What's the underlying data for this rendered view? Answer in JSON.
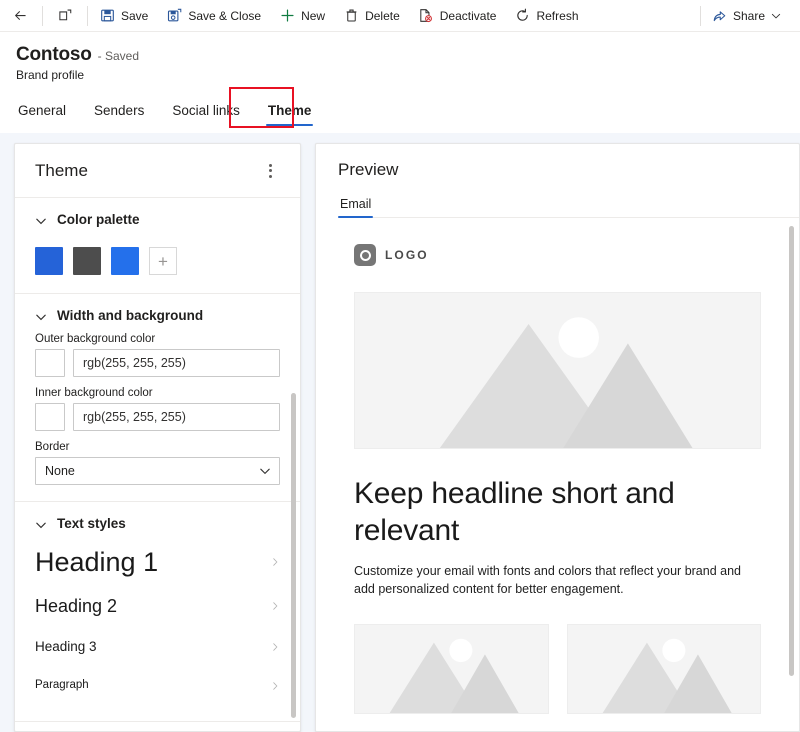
{
  "command_bar": {
    "back_label": "",
    "popout_label": "",
    "buttons": [
      {
        "id": "save",
        "label": "Save",
        "icon": "save-icon"
      },
      {
        "id": "save-close",
        "label": "Save & Close",
        "icon": "save-and-close-icon"
      },
      {
        "id": "new",
        "label": "New",
        "icon": "plus-icon"
      },
      {
        "id": "delete",
        "label": "Delete",
        "icon": "trash-icon"
      },
      {
        "id": "deactivate",
        "label": "Deactivate",
        "icon": "deactivate-icon"
      },
      {
        "id": "refresh",
        "label": "Refresh",
        "icon": "refresh-icon"
      }
    ],
    "share": {
      "label": "Share",
      "icon": "share-icon",
      "chevron": "chevron-down-icon"
    }
  },
  "record": {
    "title": "Contoso",
    "saved_status": "- Saved",
    "subtitle": "Brand profile"
  },
  "tabs": [
    {
      "label": "General",
      "selected": false
    },
    {
      "label": "Senders",
      "selected": false
    },
    {
      "label": "Social links",
      "selected": false
    },
    {
      "label": "Theme",
      "selected": true,
      "annotated": true
    }
  ],
  "annotation": {
    "color": "#e81123",
    "target": "Theme"
  },
  "theme_panel": {
    "title": "Theme",
    "overflow_label": "More commands",
    "sections": [
      {
        "id": "color-palette",
        "title": "Color palette",
        "expanded": true,
        "swatches": [
          {
            "color": "#2563d8"
          },
          {
            "color": "#4d4d4d"
          },
          {
            "color": "#2470eb"
          }
        ],
        "add_label": "+"
      },
      {
        "id": "width-and-background",
        "title": "Width and background",
        "expanded": true,
        "fields": [
          {
            "id": "outer-background-color",
            "label": "Outer background color",
            "type": "color-text",
            "value": "rgb(255, 255, 255)",
            "chip_color": "#ffffff"
          },
          {
            "id": "inner-background-color",
            "label": "Inner background color",
            "type": "color-text",
            "value": "rgb(255, 255, 255)",
            "chip_color": "#ffffff"
          },
          {
            "id": "border",
            "label": "Border",
            "type": "select",
            "value": "None"
          }
        ]
      },
      {
        "id": "text-styles",
        "title": "Text styles",
        "expanded": true,
        "styles": [
          {
            "id": "heading-1",
            "label": "Heading 1"
          },
          {
            "id": "heading-2",
            "label": "Heading 2"
          },
          {
            "id": "heading-3",
            "label": "Heading 3"
          },
          {
            "id": "paragraph",
            "label": "Paragraph"
          }
        ]
      }
    ]
  },
  "preview_panel": {
    "title": "Preview",
    "tabs": [
      {
        "label": "Email",
        "selected": true
      }
    ],
    "email": {
      "logo_text": "LOGO",
      "hero_alt": "placeholder-image",
      "headline": "Keep headline short and relevant",
      "body": "Customize your email with fonts and colors that reflect your brand and add personalized content for better engagement.",
      "cards": [
        {
          "alt": "placeholder-image"
        },
        {
          "alt": "placeholder-image"
        }
      ]
    }
  },
  "colors": {
    "accent": "#2266cc",
    "annotation": "#e81123",
    "panel_bg": "#ffffff",
    "workspace_bg": "#f3f6fb",
    "placeholder_bg": "#f4f4f4"
  }
}
